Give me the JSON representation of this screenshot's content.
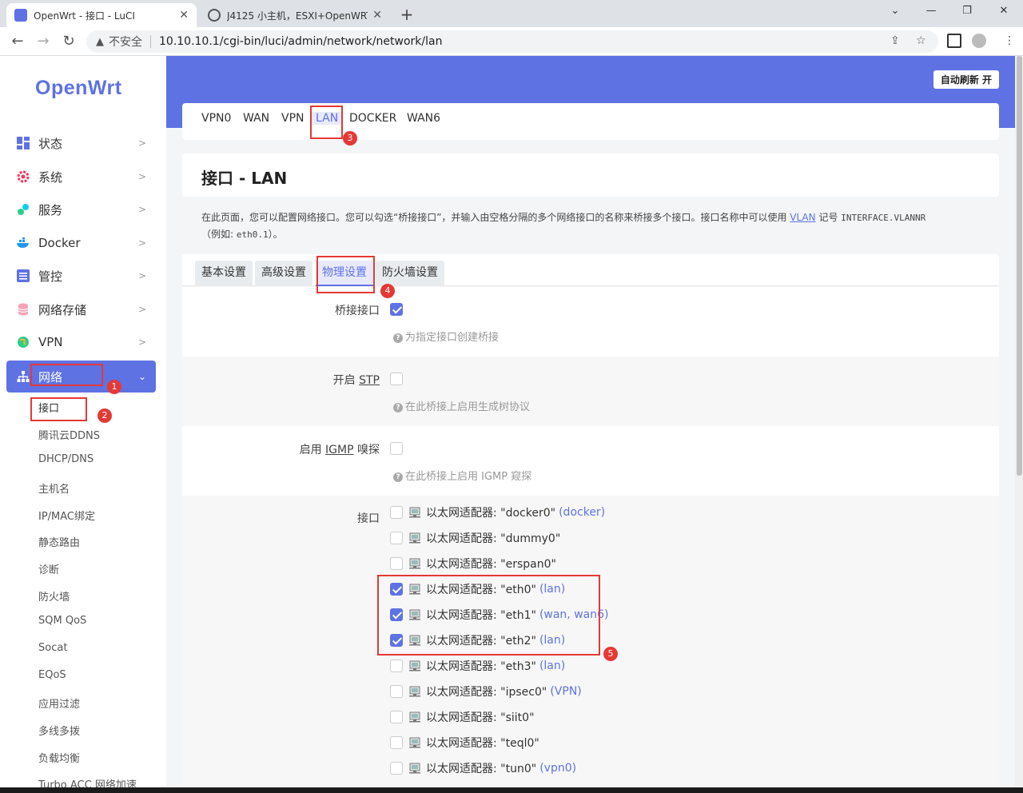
{
  "browser": {
    "tabs": [
      {
        "title": "OpenWrt - 接口 - LuCI",
        "active": true
      },
      {
        "title": "J4125 小主机，ESXI+OpenWRT",
        "active": false
      }
    ],
    "new_tab": "+",
    "window_controls": {
      "minimize": "⌄",
      "restore": "—",
      "maximize": "❐",
      "close": "✕"
    },
    "security_label": "不安全",
    "url": "10.10.10.1/cgi-bin/luci/admin/network/network/lan"
  },
  "sidebar": {
    "logo": "OpenWrt",
    "menu": [
      {
        "label": "状态"
      },
      {
        "label": "系统"
      },
      {
        "label": "服务"
      },
      {
        "label": "Docker"
      },
      {
        "label": "管控"
      },
      {
        "label": "网络存储"
      },
      {
        "label": "VPN"
      },
      {
        "label": "网络"
      }
    ],
    "submenu": [
      "接口",
      "腾讯云DDNS",
      "DHCP/DNS",
      "主机名",
      "IP/MAC绑定",
      "静态路由",
      "诊断",
      "防火墙",
      "SQM QoS",
      "Socat",
      "EQoS",
      "应用过滤",
      "多线多拨",
      "负载均衡",
      "Turbo ACC 网络加速"
    ]
  },
  "header": {
    "auto_refresh": "自动刷新 开"
  },
  "interface_tabs": [
    "VPN0",
    "WAN",
    "VPN",
    "LAN",
    "DOCKER",
    "WAN6"
  ],
  "page": {
    "title": "接口 - LAN",
    "desc_part1": "在此页面，您可以配置网络接口。您可以勾选“桥接接口”，并输入由空格分隔的多个网络接口的名称来桥接多个接口。接口名称中可以使用 ",
    "desc_vlan": "VLAN",
    "desc_part2": " 记号 ",
    "desc_code": "INTERFACE.VLANNR",
    "desc_part3": "（例如: ",
    "desc_code2": "eth0.1",
    "desc_part4": "）。"
  },
  "section_tabs": [
    "基本设置",
    "高级设置",
    "物理设置",
    "防火墙设置"
  ],
  "options": {
    "bridge": {
      "label": "桥接接口",
      "checked": true,
      "hint": "为指定接口创建桥接"
    },
    "stp": {
      "label_prefix": "开启 ",
      "label_abbr": "STP",
      "checked": false,
      "hint": "在此桥接上启用生成树协议"
    },
    "igmp": {
      "label_prefix": "启用 ",
      "label_abbr": "IGMP",
      "label_suffix": " 嗅探",
      "checked": false,
      "hint": "在此桥接上启用 IGMP 窥探"
    },
    "ifaces_label": "接口"
  },
  "interfaces": [
    {
      "name": "以太网适配器: \"docker0\"",
      "zone": "(docker)",
      "checked": false
    },
    {
      "name": "以太网适配器: \"dummy0\"",
      "zone": "",
      "checked": false
    },
    {
      "name": "以太网适配器: \"erspan0\"",
      "zone": "",
      "checked": false
    },
    {
      "name": "以太网适配器: \"eth0\"",
      "zone": "(lan)",
      "checked": true
    },
    {
      "name": "以太网适配器: \"eth1\"",
      "zone": "(wan, wan6)",
      "checked": true
    },
    {
      "name": "以太网适配器: \"eth2\"",
      "zone": "(lan)",
      "checked": true
    },
    {
      "name": "以太网适配器: \"eth3\"",
      "zone": "(lan)",
      "checked": false
    },
    {
      "name": "以太网适配器: \"ipsec0\"",
      "zone": "(VPN)",
      "checked": false
    },
    {
      "name": "以太网适配器: \"siit0\"",
      "zone": "",
      "checked": false
    },
    {
      "name": "以太网适配器: \"teql0\"",
      "zone": "",
      "checked": false
    },
    {
      "name": "以太网适配器: \"tun0\"",
      "zone": "(vpn0)",
      "checked": false
    }
  ],
  "annotations": [
    "1",
    "2",
    "3",
    "4",
    "5"
  ],
  "colors": {
    "accent": "#5e72e4",
    "annotation": "#e53935"
  }
}
